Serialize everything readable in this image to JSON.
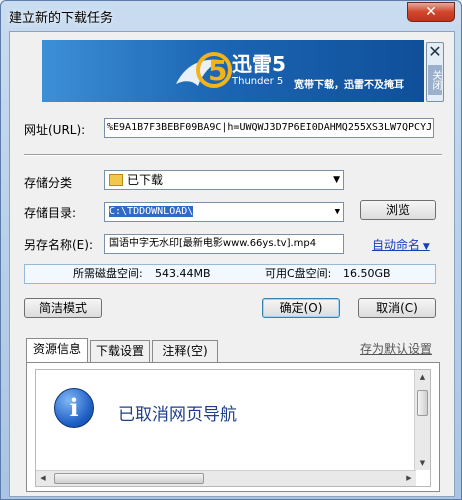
{
  "window": {
    "title": "建立新的下载任务",
    "close_glyph": "✕"
  },
  "banner": {
    "brand": "迅雷5",
    "subtitle": "Thunder 5",
    "slogan": "宽带下载，迅雷不及掩耳",
    "logo_digit": "5",
    "side_close_glyph": "✕",
    "side_close_label": "关闭"
  },
  "form": {
    "url_label": "网址(URL):",
    "url_value": "%E9A1B7F3BEBF09BA9C|h=UWQWJ3D7P6EI0DAHMQ255XS3LW7QPCYJ|",
    "category_label": "存储分类",
    "category_value": "已下载",
    "dir_label": "存储目录:",
    "dir_value": "C:\\TDDOWNLOAD\\",
    "browse_label": "浏览",
    "saveas_label": "另存名称(E):",
    "saveas_value": "国语中字无水印[最新电影www.66ys.tv].mp4",
    "auto_name_label": "自动命名"
  },
  "disk": {
    "required_label": "所需磁盘空间:",
    "required_value": "543.44MB",
    "available_label": "可用C盘空间:",
    "available_value": "16.50GB"
  },
  "buttons": {
    "simple_mode": "简洁模式",
    "ok": "确定(O)",
    "cancel": "取消(C)"
  },
  "tabs": [
    {
      "label": "资源信息"
    },
    {
      "label": "下载设置"
    },
    {
      "label": "注释(空)"
    }
  ],
  "set_default_label": "存为默认设置",
  "panel": {
    "info_glyph": "i",
    "message": "已取消网页导航"
  },
  "colors": {
    "banner": "#1c66b4",
    "link": "#1a3fb5",
    "title_bar": "#a9c4e4"
  }
}
